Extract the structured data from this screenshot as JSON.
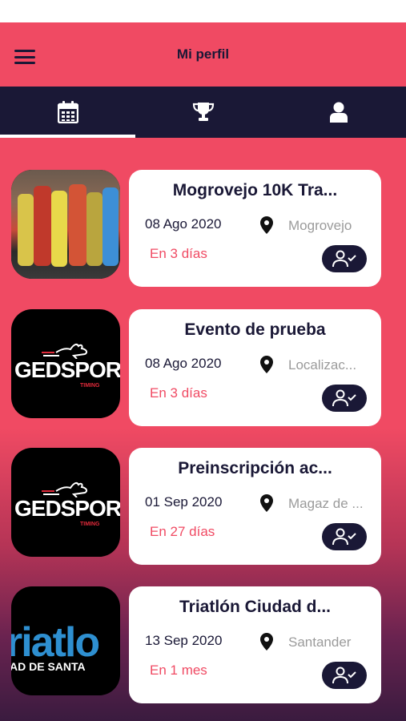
{
  "app": {
    "title": "Mi perfil"
  },
  "tabs": [
    {
      "name": "calendar-icon",
      "active": true
    },
    {
      "name": "trophy-icon",
      "active": false
    },
    {
      "name": "user-icon",
      "active": false
    }
  ],
  "events": [
    {
      "title": "Mogrovejo 10K Tra...",
      "date": "08 Ago 2020",
      "location": "Mogrovejo",
      "when": "En  3 días",
      "thumb": "photo"
    },
    {
      "title": "Evento de prueba",
      "date": "08 Ago 2020",
      "location": "Localizac...",
      "when": "En  3 días",
      "thumb": "gedsports",
      "thumb_text": "GEDSPORTS",
      "thumb_sub": "TIMING"
    },
    {
      "title": "Preinscripción ac...",
      "date": "01 Sep 2020",
      "location": "Magaz de ...",
      "when": "En  27 días",
      "thumb": "gedsports",
      "thumb_text": "GEDSPORTS",
      "thumb_sub": "TIMING"
    },
    {
      "title": "Triatlón Ciudad d...",
      "date": "13 Sep 2020",
      "location": "Santander",
      "when": "En  1 mes",
      "thumb": "triatlon",
      "thumb_text": "riatlo",
      "thumb_sub": "AD DE SANTA"
    }
  ],
  "colors": {
    "accent": "#f04a63",
    "navy": "#1a1836"
  }
}
